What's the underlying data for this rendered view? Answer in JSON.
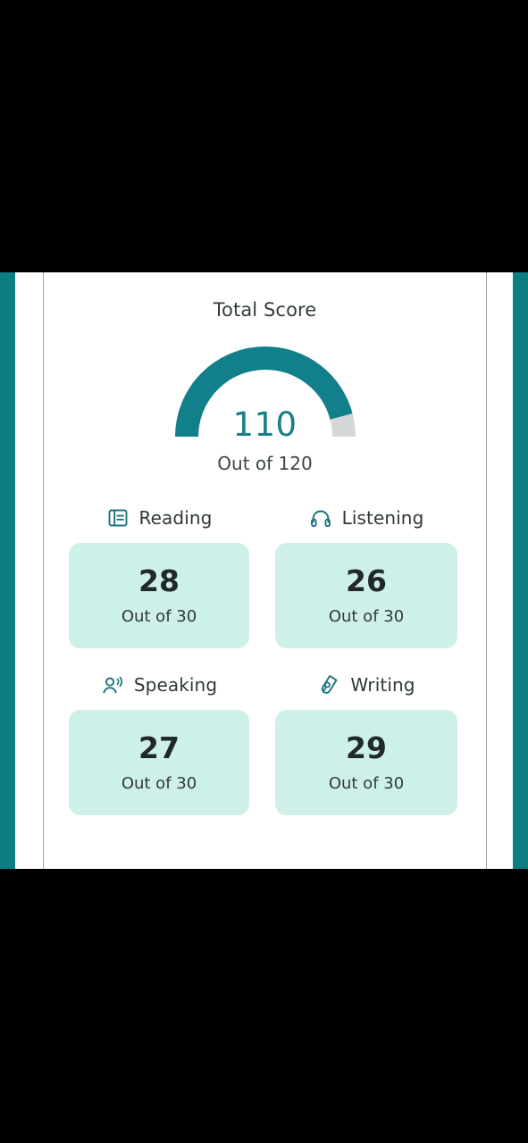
{
  "theme": {
    "accent": "#0b7d83",
    "gauge_fill": "#12808a",
    "gauge_track": "#d4d7d8",
    "value_color": "#1a7f88",
    "card_bg": "#cdf0e8",
    "text_dark": "#2f3739",
    "panel_bg": "#ffffff",
    "backdrop": "#000000"
  },
  "total": {
    "title": "Total Score",
    "value": "110",
    "value_number": 110,
    "max_number": 120,
    "out_of": "Out of 120"
  },
  "sections": [
    {
      "id": "reading",
      "label": "Reading",
      "icon": "book-open-icon",
      "score": "28",
      "out_of": "Out of 30",
      "score_number": 28,
      "max_number": 30
    },
    {
      "id": "listening",
      "label": "Listening",
      "icon": "headphones-icon",
      "score": "26",
      "out_of": "Out of 30",
      "score_number": 26,
      "max_number": 30
    },
    {
      "id": "speaking",
      "label": "Speaking",
      "icon": "person-speaking-icon",
      "score": "27",
      "out_of": "Out of 30",
      "score_number": 27,
      "max_number": 30
    },
    {
      "id": "writing",
      "label": "Writing",
      "icon": "pen-nib-icon",
      "score": "29",
      "out_of": "Out of 30",
      "score_number": 29,
      "max_number": 30
    }
  ]
}
